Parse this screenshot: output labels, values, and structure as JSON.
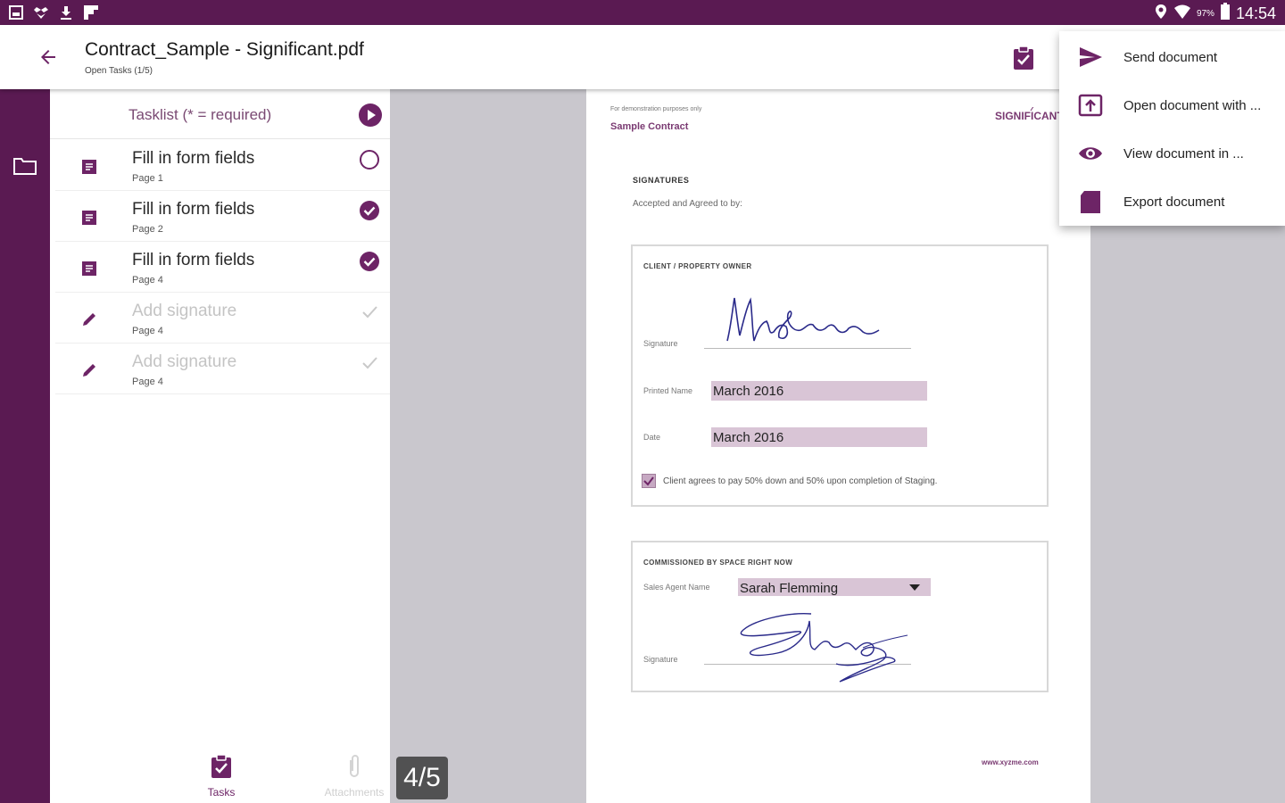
{
  "status_bar": {
    "battery_percent": "97%",
    "time": "14:54"
  },
  "app_bar": {
    "title": "Contract_Sample - Significant.pdf",
    "subtitle": "Open Tasks (1/5)"
  },
  "tasklist": {
    "header": "Tasklist (* = required)",
    "tasks": [
      {
        "label": "Fill in form fields",
        "page": "Page 1",
        "type": "form",
        "status": "open"
      },
      {
        "label": "Fill in form fields",
        "page": "Page 2",
        "type": "form",
        "status": "done"
      },
      {
        "label": "Fill in form fields",
        "page": "Page 4",
        "type": "form",
        "status": "done"
      },
      {
        "label": "Add signature",
        "page": "Page 4",
        "type": "signature",
        "status": "signed"
      },
      {
        "label": "Add signature",
        "page": "Page 4",
        "type": "signature",
        "status": "signed"
      }
    ]
  },
  "bottom_nav": {
    "tasks": "Tasks",
    "attachments": "Attachments"
  },
  "page_indicator": "4/5",
  "document": {
    "demo_note": "For demonstration purposes only",
    "title": "Sample Contract",
    "logo_text": "SIGNIFICANT",
    "section": "SIGNATURES",
    "accepted": "Accepted and Agreed to by:",
    "owner_box": {
      "heading": "CLIENT / PROPERTY OWNER",
      "signature_label": "Signature",
      "printed_name_label": "Printed Name",
      "printed_name_value": "March 2016",
      "date_label": "Date",
      "date_value": "March 2016",
      "checkbox_text": "Client agrees to pay 50% down and 50% upon completion of Staging."
    },
    "agent_box": {
      "heading": "COMMISSIONED BY SPACE RIGHT NOW",
      "agent_label": "Sales Agent Name",
      "agent_value": "Sarah Flemming",
      "signature_label": "Signature"
    },
    "footer_url": "www.xyzme.com"
  },
  "menu": {
    "items": [
      {
        "label": "Send document",
        "icon": "send-icon"
      },
      {
        "label": "Open document with ...",
        "icon": "open-with-icon"
      },
      {
        "label": "View document in ...",
        "icon": "eye-icon"
      },
      {
        "label": "Export document",
        "icon": "export-icon"
      }
    ]
  },
  "colors": {
    "brand": "#5a1a52",
    "accent": "#6d2466",
    "field_fill": "#d9c5d6",
    "signature_ink": "#2a2a8a"
  }
}
